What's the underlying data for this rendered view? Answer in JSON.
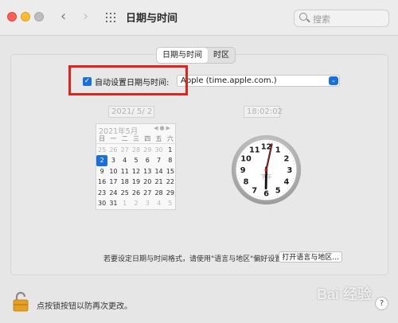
{
  "window": {
    "title": "日期与时间",
    "search_placeholder": "搜索",
    "icons": [
      "back-icon",
      "forward-icon",
      "grid-icon",
      "search-icon",
      "lock-icon",
      "help-icon"
    ]
  },
  "tabs": [
    {
      "label": "日期与时间",
      "active": true
    },
    {
      "label": "时区",
      "active": false
    }
  ],
  "auto_set": {
    "label": "自动设置日期与时间:",
    "checked": true,
    "server": "Apple (time.apple.com.)"
  },
  "date_field": "2021/ 5/ 2",
  "time_field": "18:02:02",
  "calendar": {
    "month_label": "2021年5月",
    "weekdays": [
      "日",
      "一",
      "二",
      "三",
      "四",
      "五",
      "六"
    ],
    "weeks": [
      [
        "25",
        "26",
        "27",
        "28",
        "29",
        "30",
        "1"
      ],
      [
        "2",
        "3",
        "4",
        "5",
        "6",
        "7",
        "8"
      ],
      [
        "9",
        "10",
        "11",
        "12",
        "13",
        "14",
        "15"
      ],
      [
        "16",
        "17",
        "18",
        "19",
        "20",
        "21",
        "22"
      ],
      [
        "23",
        "24",
        "25",
        "26",
        "27",
        "28",
        "29"
      ],
      [
        "30",
        "31",
        "1",
        "2",
        "3",
        "4",
        "5"
      ]
    ],
    "selected": "2"
  },
  "clock": {
    "numbers": [
      "12",
      "1",
      "2",
      "3",
      "4",
      "5",
      "6",
      "7",
      "8",
      "9",
      "10",
      "11"
    ],
    "ampm": "下午",
    "hour": 18,
    "minute": 2,
    "second": 2
  },
  "note": "若要设定日期与时间格式，请使用\"语言与地区\"偏好设置。",
  "open_lang_button": "打开语言与地区...",
  "lock_text": "点按锁按钮以防再次更改。",
  "help": "?",
  "watermark": "Bai 经验",
  "colors": {
    "accent": "#1a6fe0",
    "highlight_box": "#e3221c",
    "clock_hand_second": "#b3201c"
  }
}
